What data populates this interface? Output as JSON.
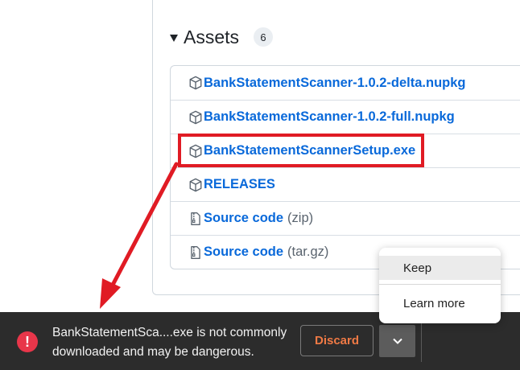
{
  "assets": {
    "title": "Assets",
    "count": "6",
    "items": [
      {
        "name": "BankStatementScanner-1.0.2-delta.nupkg",
        "suffix": "",
        "icon": "package-icon"
      },
      {
        "name": "BankStatementScanner-1.0.2-full.nupkg",
        "suffix": "",
        "icon": "package-icon"
      },
      {
        "name": "BankStatementScannerSetup.exe",
        "suffix": "",
        "icon": "package-icon"
      },
      {
        "name": "RELEASES",
        "suffix": "",
        "icon": "package-icon"
      },
      {
        "name": "Source code",
        "suffix": "(zip)",
        "icon": "file-zip-icon"
      },
      {
        "name": "Source code",
        "suffix": "(tar.gz)",
        "icon": "file-zip-icon"
      }
    ]
  },
  "download_bar": {
    "warning_line1": "BankStatementSca....exe is not commonly",
    "warning_line2": "downloaded and may be dangerous.",
    "discard_label": "Discard",
    "icon": "warning-circle-icon"
  },
  "popup_menu": {
    "keep_label": "Keep",
    "learn_more_label": "Learn more"
  },
  "colors": {
    "highlight": "#e01b24",
    "link": "#0969da",
    "discard": "#f07a45",
    "warning": "#e8364a"
  }
}
